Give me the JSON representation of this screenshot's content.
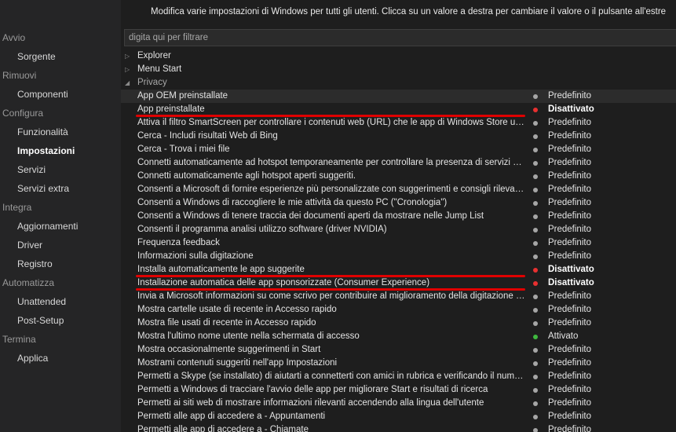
{
  "description": "Modifica varie impostazioni di Windows per tutti gli utenti. Clicca su un valore a destra per cambiare il valore o il pulsante all'estre",
  "filter": {
    "value": "",
    "placeholder": "digita qui per filtrare"
  },
  "colors": {
    "default": "#a6a6a6",
    "disabled": "#e83030",
    "enabled": "#3fb83f",
    "highlight": "#e00000"
  },
  "sidebar": [
    {
      "label": "Avvio",
      "type": "section"
    },
    {
      "label": "Sorgente",
      "type": "item"
    },
    {
      "label": "Rimuovi",
      "type": "section"
    },
    {
      "label": "Componenti",
      "type": "item"
    },
    {
      "label": "Configura",
      "type": "section"
    },
    {
      "label": "Funzionalità",
      "type": "item"
    },
    {
      "label": "Impostazioni",
      "type": "item",
      "active": true
    },
    {
      "label": "Servizi",
      "type": "item"
    },
    {
      "label": "Servizi extra",
      "type": "item"
    },
    {
      "label": "Integra",
      "type": "section"
    },
    {
      "label": "Aggiornamenti",
      "type": "item"
    },
    {
      "label": "Driver",
      "type": "item"
    },
    {
      "label": "Registro",
      "type": "item"
    },
    {
      "label": "Automatizza",
      "type": "section"
    },
    {
      "label": "Unattended",
      "type": "item"
    },
    {
      "label": "Post-Setup",
      "type": "item"
    },
    {
      "label": "Termina",
      "type": "section"
    },
    {
      "label": "Applica",
      "type": "item"
    }
  ],
  "groups": [
    {
      "label": "Explorer",
      "expanded": false,
      "icon": "triangle-right-icon"
    },
    {
      "label": "Menu Start",
      "expanded": false,
      "icon": "triangle-right-icon"
    },
    {
      "label": "Privacy",
      "expanded": true,
      "icon": "triangle-down-icon"
    }
  ],
  "settings": [
    {
      "name": "App OEM preinstallate",
      "value": "Predefinito",
      "status": "default",
      "selected": true
    },
    {
      "name": "App preinstallate",
      "value": "Disattivato",
      "status": "disabled",
      "highlight": true
    },
    {
      "name": "Attiva il filtro SmartScreen per controllare i contenuti web (URL) che le app di Windows Store usano",
      "value": "Predefinito",
      "status": "default"
    },
    {
      "name": "Cerca - Includi risultati Web di Bing",
      "value": "Predefinito",
      "status": "default"
    },
    {
      "name": "Cerca - Trova i miei file",
      "value": "Predefinito",
      "status": "default"
    },
    {
      "name": "Connetti automaticamente ad hotspot temporaneamente per controllare la presenza di servizi di rete a p...",
      "value": "Predefinito",
      "status": "default"
    },
    {
      "name": "Connetti automaticamente agli hotspot aperti suggeriti.",
      "value": "Predefinito",
      "status": "default"
    },
    {
      "name": "Consenti a Microsoft di fornire esperienze più personalizzate con suggerimenti e consigli rilevanti utilizza...",
      "value": "Predefinito",
      "status": "default"
    },
    {
      "name": "Consenti a Windows di raccogliere le mie attività da questo PC (\"Cronologia\")",
      "value": "Predefinito",
      "status": "default"
    },
    {
      "name": "Consenti a Windows di tenere traccia dei documenti aperti da mostrare nelle Jump List",
      "value": "Predefinito",
      "status": "default"
    },
    {
      "name": "Consenti il programma analisi utilizzo software (driver NVIDIA)",
      "value": "Predefinito",
      "status": "default"
    },
    {
      "name": "Frequenza feedback",
      "value": "Predefinito",
      "status": "default"
    },
    {
      "name": "Informazioni sulla digitazione",
      "value": "Predefinito",
      "status": "default"
    },
    {
      "name": "Installa automaticamente le app suggerite",
      "value": "Disattivato",
      "status": "disabled",
      "highlight": true
    },
    {
      "name": "Installazione automatica delle app sponsorizzate (Consumer Experience)",
      "value": "Disattivato",
      "status": "disabled",
      "highlight": true
    },
    {
      "name": "Invia a Microsoft informazioni su come scrivo per contribuire al miglioramento della digitazione e della scr...",
      "value": "Predefinito",
      "status": "default"
    },
    {
      "name": "Mostra cartelle usate di recente in Accesso rapido",
      "value": "Predefinito",
      "status": "default"
    },
    {
      "name": "Mostra file usati di recente in Accesso rapido",
      "value": "Predefinito",
      "status": "default"
    },
    {
      "name": "Mostra l'ultimo nome utente nella schermata di accesso",
      "value": "Attivato",
      "status": "enabled"
    },
    {
      "name": "Mostra occasionalmente suggerimenti in Start",
      "value": "Predefinito",
      "status": "default"
    },
    {
      "name": "Mostrami contenuti suggeriti nell'app Impostazioni",
      "value": "Predefinito",
      "status": "default"
    },
    {
      "name": "Permetti a Skype (se installato) di aiutarti a connetterti con amici in rubrica e verificando il numero di tele...",
      "value": "Predefinito",
      "status": "default"
    },
    {
      "name": "Permetti a Windows di tracciare l'avvio delle app per migliorare Start e risultati di ricerca",
      "value": "Predefinito",
      "status": "default"
    },
    {
      "name": "Permetti ai siti web di mostrare informazioni rilevanti accendendo alla lingua dell'utente",
      "value": "Predefinito",
      "status": "default"
    },
    {
      "name": "Permetti alle app di accedere a - Appuntamenti",
      "value": "Predefinito",
      "status": "default"
    },
    {
      "name": "Permetti alle app di accedere a - Chiamate",
      "value": "Predefinito",
      "status": "default"
    }
  ]
}
